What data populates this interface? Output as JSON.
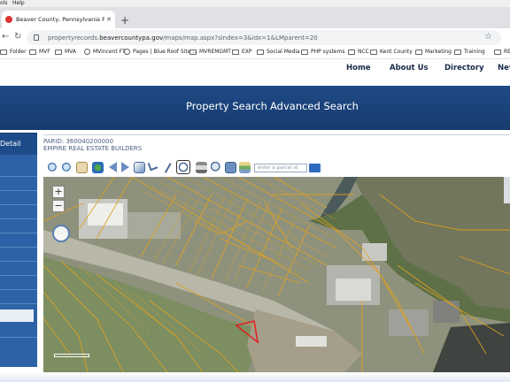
{
  "browser": {
    "menu": {
      "tools_fragment": "ols",
      "help": "Help"
    },
    "tab": {
      "title": "Beaver County, Pennsylvania Prope",
      "close": "✕"
    },
    "new_tab": "+",
    "nav": {
      "back": "←",
      "forward": "→",
      "reload": "↻"
    },
    "url": {
      "prefix": "propertyrecords.",
      "host": "beavercountypa.gov",
      "path": "/maps/map.aspx?sIndex=3&idx=1&LMparent=20"
    },
    "star": "☆",
    "bookmarks": [
      {
        "label": "Folder",
        "icon": "folder-icon"
      },
      {
        "label": "MVF",
        "icon": "folder-icon"
      },
      {
        "label": "MVA",
        "icon": "folder-icon"
      },
      {
        "label": "MVincent FT",
        "icon": "globe-icon"
      },
      {
        "label": "Pages | Blue Roof Site ...",
        "icon": "globe-icon"
      },
      {
        "label": "MVREMGMT",
        "icon": "folder-icon"
      },
      {
        "label": "EXP",
        "icon": "folder-icon"
      },
      {
        "label": "Social Media",
        "icon": "folder-icon"
      },
      {
        "label": "PHP systems",
        "icon": "folder-icon"
      },
      {
        "label": "NCC",
        "icon": "folder-icon"
      },
      {
        "label": "Kent County",
        "icon": "folder-icon"
      },
      {
        "label": "Marketing",
        "icon": "folder-icon"
      },
      {
        "label": "Training",
        "icon": "folder-icon"
      },
      {
        "label": "RE so",
        "icon": "folder-icon"
      }
    ]
  },
  "site": {
    "top_nav": [
      "Home",
      "About Us",
      "Directory",
      "Nev"
    ],
    "band_links": [
      "Property Search",
      "Advanced Search"
    ],
    "left_panel_label": "Detail",
    "parcel_id": "PARID: 360040200000",
    "owner": "EMPIRE REAL ESTATE BUILDERS",
    "parcel_search_placeholder": "enter a parcel id"
  },
  "map": {
    "zoom_in": "+",
    "zoom_out": "−"
  },
  "colors": {
    "site_blue": "#1e4a86",
    "parcel_lines": "#e0a020",
    "selected_parcel": "#e02020"
  }
}
